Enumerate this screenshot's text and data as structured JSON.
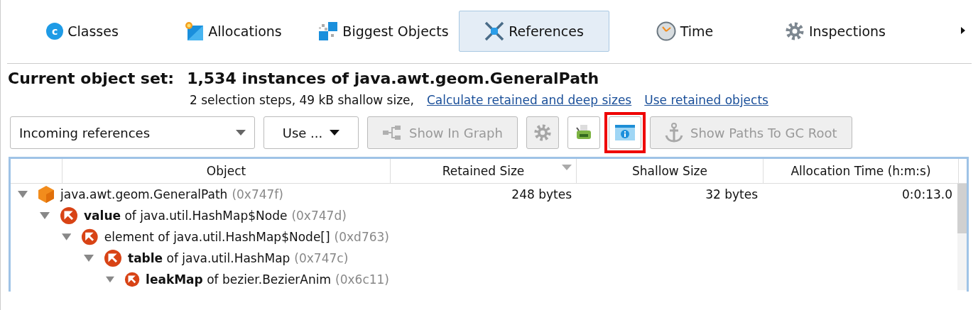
{
  "tabs": [
    {
      "label": "Classes",
      "icon_letter": "c",
      "selected": false
    },
    {
      "label": "Allocations",
      "selected": false
    },
    {
      "label": "Biggest Objects",
      "selected": false
    },
    {
      "label": "References",
      "selected": true
    },
    {
      "label": "Time",
      "selected": false
    },
    {
      "label": "Inspections",
      "selected": false
    }
  ],
  "object_set": {
    "label": "Current object set:",
    "value": "1,534 instances of java.awt.geom.GeneralPath",
    "details": "2 selection steps, 49 kB shallow size,",
    "links": [
      "Calculate retained and deep sizes",
      "Use retained objects"
    ]
  },
  "toolbar": [
    {
      "kind": "dropdown",
      "label": "Incoming references",
      "disabled": false,
      "highlighted": false
    },
    {
      "kind": "menu",
      "label": "Use ...",
      "disabled": false,
      "highlighted": false
    },
    {
      "kind": "button",
      "label": "Show In Graph",
      "disabled": true,
      "highlighted": false
    },
    {
      "kind": "icon",
      "disabled": true,
      "highlighted": false
    },
    {
      "kind": "icon",
      "disabled": false,
      "highlighted": false
    },
    {
      "kind": "icon",
      "disabled": false,
      "highlighted": true
    },
    {
      "kind": "button",
      "label": "Show Paths To GC Root",
      "disabled": true,
      "highlighted": false
    }
  ],
  "table": {
    "columns": [
      {
        "label": "Object",
        "sorted": false
      },
      {
        "label": "Retained Size",
        "sorted": true
      },
      {
        "label": "Shallow Size",
        "sorted": false
      },
      {
        "label": "Allocation Time (h:m:s)",
        "sorted": false
      }
    ],
    "rows": [
      {
        "kind": "object",
        "text": "java.awt.geom.GeneralPath",
        "address": "(0x747f)",
        "retained_size": "248 bytes",
        "shallow_size": "32 bytes",
        "allocation_time": "0:0:13.0",
        "expanded": true,
        "children": [
          {
            "kind": "reference",
            "text": "**value** of java.util.HashMap$Node",
            "address": "(0x747d)",
            "expanded": true,
            "children": [
              {
                "kind": "reference",
                "text": "element of java.util.HashMap$Node[]",
                "address": "(0xd763)",
                "expanded": true,
                "children": [
                  {
                    "kind": "reference",
                    "text": "**table** of java.util.HashMap",
                    "address": "(0x747c)",
                    "expanded": true,
                    "children": [
                      {
                        "kind": "reference",
                        "text": "**leakMap** of bezier.BezierAnim",
                        "address": "(0x6c11)",
                        "expanded": true
                      }
                    ]
                  }
                ]
              }
            ]
          }
        ]
      }
    ]
  }
}
